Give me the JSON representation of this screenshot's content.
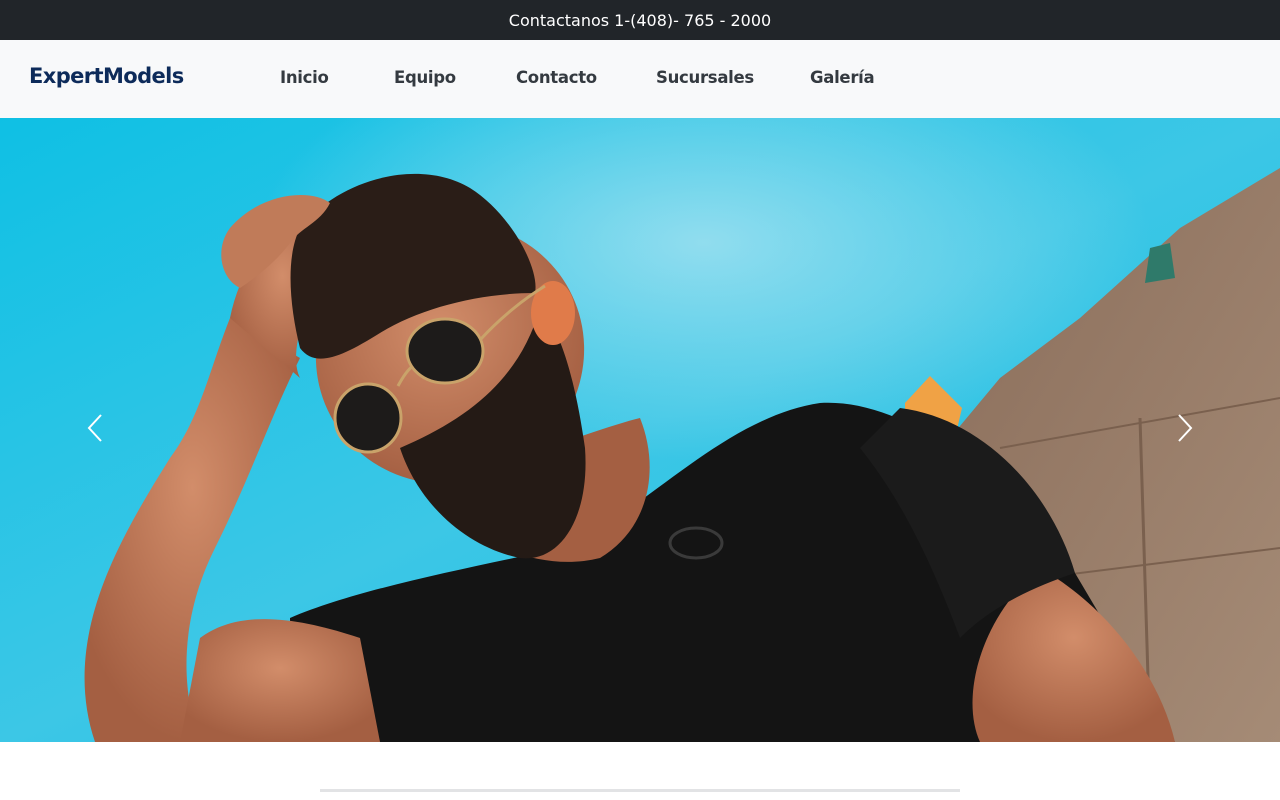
{
  "topbar": {
    "contact_text": "Contactanos 1-(408)- 765 - 2000"
  },
  "navbar": {
    "brand": "ExpertModels",
    "links": [
      {
        "label": "Inicio"
      },
      {
        "label": "Equipo"
      },
      {
        "label": "Contacto"
      },
      {
        "label": "Sucursales"
      },
      {
        "label": "Galería"
      }
    ]
  },
  "carousel": {
    "slide_icon": "carousel-photo",
    "prev_icon": "chevron-left-icon",
    "next_icon": "chevron-right-icon"
  },
  "colors": {
    "topbar_bg": "#212529",
    "navbar_bg": "#f8f9fa",
    "brand": "#0d2b5a",
    "nav_link": "#343a40",
    "sky": "#18bde0"
  }
}
